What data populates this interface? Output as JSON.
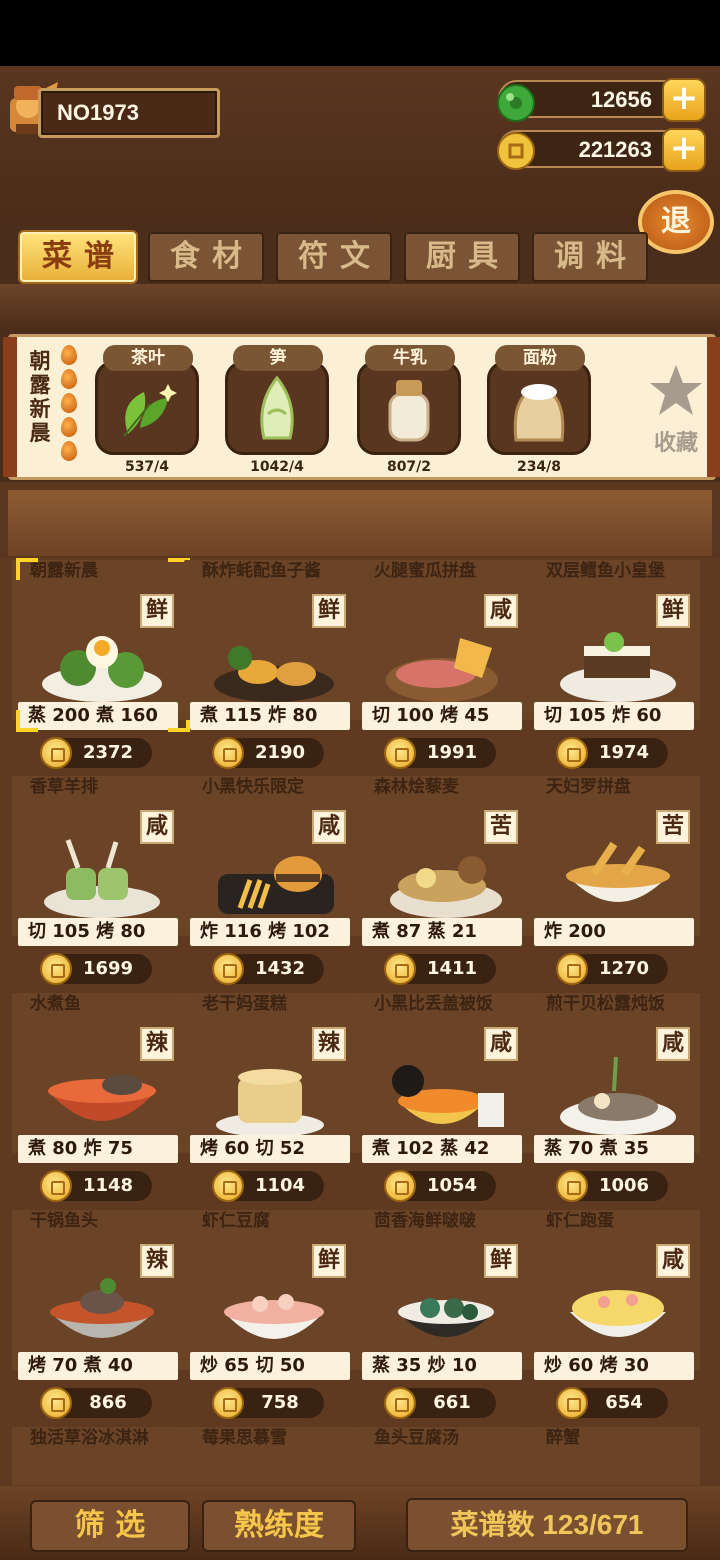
{
  "player": {
    "name": "NO1973"
  },
  "resources": {
    "jade": "12656",
    "coins": "221263"
  },
  "exit_label": "退",
  "tabs": [
    "菜谱",
    "食材",
    "符文",
    "厨具",
    "调料"
  ],
  "selected_recipe": {
    "name": "朝露新晨",
    "ingredients": [
      {
        "name": "茶叶",
        "count": "537/4",
        "icon": "tea-leaf-icon"
      },
      {
        "name": "笋",
        "count": "1042/4",
        "icon": "bamboo-shoot-icon"
      },
      {
        "name": "牛乳",
        "count": "807/2",
        "icon": "milk-jar-icon"
      },
      {
        "name": "面粉",
        "count": "234/8",
        "icon": "flour-sack-icon"
      }
    ],
    "favorite_label": "收藏"
  },
  "recipes": [
    {
      "name": "朝露新晨",
      "flavor": "鲜",
      "stats": "蒸 200  煮 160",
      "price": "2372"
    },
    {
      "name": "酥炸蚝配鱼子酱",
      "flavor": "鲜",
      "stats": "煮 115  炸 80",
      "price": "2190"
    },
    {
      "name": "火腿蜜瓜拼盘",
      "flavor": "咸",
      "stats": "切 100  烤 45",
      "price": "1991"
    },
    {
      "name": "双层鳕鱼小皇堡",
      "flavor": "鲜",
      "stats": "切 105  炸 60",
      "price": "1974"
    },
    {
      "name": "香草羊排",
      "flavor": "咸",
      "stats": "切 105  烤 80",
      "price": "1699"
    },
    {
      "name": "小黑快乐限定",
      "flavor": "咸",
      "stats": "炸 116  烤 102",
      "price": "1432"
    },
    {
      "name": "森林烩藜麦",
      "flavor": "苦",
      "stats": "煮 87  蒸 21",
      "price": "1411"
    },
    {
      "name": "天妇罗拼盘",
      "flavor": "苦",
      "stats": "      炸 200",
      "price": "1270"
    },
    {
      "name": "水煮鱼",
      "flavor": "辣",
      "stats": "煮 80  炸 75",
      "price": "1148"
    },
    {
      "name": "老干妈蛋糕",
      "flavor": "辣",
      "stats": "烤 60  切 52",
      "price": "1104"
    },
    {
      "name": "小黑比丢盖被饭",
      "flavor": "咸",
      "stats": "煮 102  蒸 42",
      "price": "1054"
    },
    {
      "name": "煎干贝松露炖饭",
      "flavor": "咸",
      "stats": "蒸 70  煮 35",
      "price": "1006"
    },
    {
      "name": "干锅鱼头",
      "flavor": "辣",
      "stats": "烤 70  煮 40",
      "price": "866"
    },
    {
      "name": "虾仁豆腐",
      "flavor": "鲜",
      "stats": "炒 65  切 50",
      "price": "758"
    },
    {
      "name": "茴香海鲜啵啵",
      "flavor": "鲜",
      "stats": "蒸 35  炒 10",
      "price": "661"
    },
    {
      "name": "虾仁跑蛋",
      "flavor": "咸",
      "stats": "炒 60  烤 30",
      "price": "654"
    },
    {
      "name": "独活草浴冰淇淋",
      "flavor": "",
      "stats": "",
      "price": ""
    },
    {
      "name": "莓果思慕雪",
      "flavor": "",
      "stats": "",
      "price": ""
    },
    {
      "name": "鱼头豆腐汤",
      "flavor": "",
      "stats": "",
      "price": ""
    },
    {
      "name": "醉蟹",
      "flavor": "",
      "stats": "",
      "price": ""
    }
  ],
  "bottom": {
    "filter_label": "筛 选",
    "proficiency_label": "熟练度",
    "recipe_count": "菜谱数 123/671"
  },
  "colors": {
    "gold": "#f5c64a",
    "wood": "#603a20",
    "accent": "#e9b13a"
  }
}
